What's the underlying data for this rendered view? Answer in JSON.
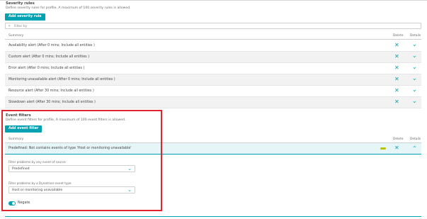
{
  "severity": {
    "title": "Severity rules",
    "description": "Define severity rules for profile. A maximum of 100 severity rules is allowed.",
    "add_button": "Add severity rule",
    "filter_placeholder": "Filter by",
    "headers": {
      "summary": "Summary",
      "delete": "Delete",
      "details": "Details"
    },
    "rows": [
      {
        "label": "Availability alert (After 0 mins; Include all entities )"
      },
      {
        "label": "Custom alert (After 0 mins; Include all entities )"
      },
      {
        "label": "Error alert (After 0 mins; Include all entities )"
      },
      {
        "label": "Monitoring unavailable alert (After 0 mins; Include all entities )"
      },
      {
        "label": "Resource alert (After 30 mins; Include all entities )"
      },
      {
        "label": "Slowdown alert (After 30 mins; Include all entities )"
      }
    ]
  },
  "events": {
    "title": "Event filters",
    "description": "Define event filters for profile. A maximum of 100 event filters is allowed.",
    "add_button": "Add event filter",
    "headers": {
      "summary": "Summary",
      "delete": "Delete",
      "details": "Details"
    },
    "expanded_row": {
      "label": "Predefined: Not contains events of type 'Host or monitoring unavailable'",
      "source_label": "Filter problems by any event of source",
      "source_value": "Predefined",
      "type_label": "Filter problems by a Dynatrace event type",
      "type_value": "Host or monitoring unavailable",
      "negate_label": "Negate",
      "negate_on": true
    }
  },
  "icons": {
    "delete": "close-icon",
    "expand": "chevron-down-icon",
    "collapse": "chevron-up-icon",
    "filter": "filter-icon"
  },
  "colors": {
    "accent": "#00a1b2",
    "highlight_box": "#e0242e",
    "status_pill": "#b8c400"
  }
}
